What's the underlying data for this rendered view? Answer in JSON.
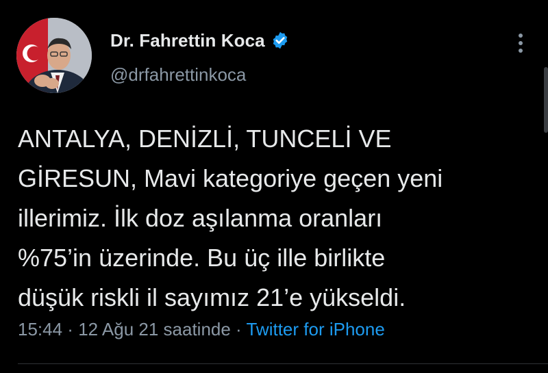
{
  "user": {
    "display_name": "Dr. Fahrettin Koca",
    "handle": "@drfahrettinkoca",
    "verified_icon": "verified-badge-icon",
    "avatar_icon": "profile-photo"
  },
  "tweet": {
    "text": "ANTALYA, DENİZLİ, TUNCELİ VE\nGİRESUN, Mavi kategoriye geçen yeni\nillerimiz. İlk doz aşılanma oranları\n%75’in üzerinde. Bu üç ille birlikte\ndüşük riskli il sayımız 21’e yükseldi."
  },
  "meta": {
    "time": "15:44",
    "separator": " · ",
    "date": "12 Ağu 21 saatinde",
    "source": "Twitter for iPhone"
  },
  "colors": {
    "background": "#000000",
    "text": "#e7e9ea",
    "secondary": "#8b98a5",
    "accent": "#1d9bf0"
  },
  "menu": {
    "icon": "more-vertical-icon"
  }
}
